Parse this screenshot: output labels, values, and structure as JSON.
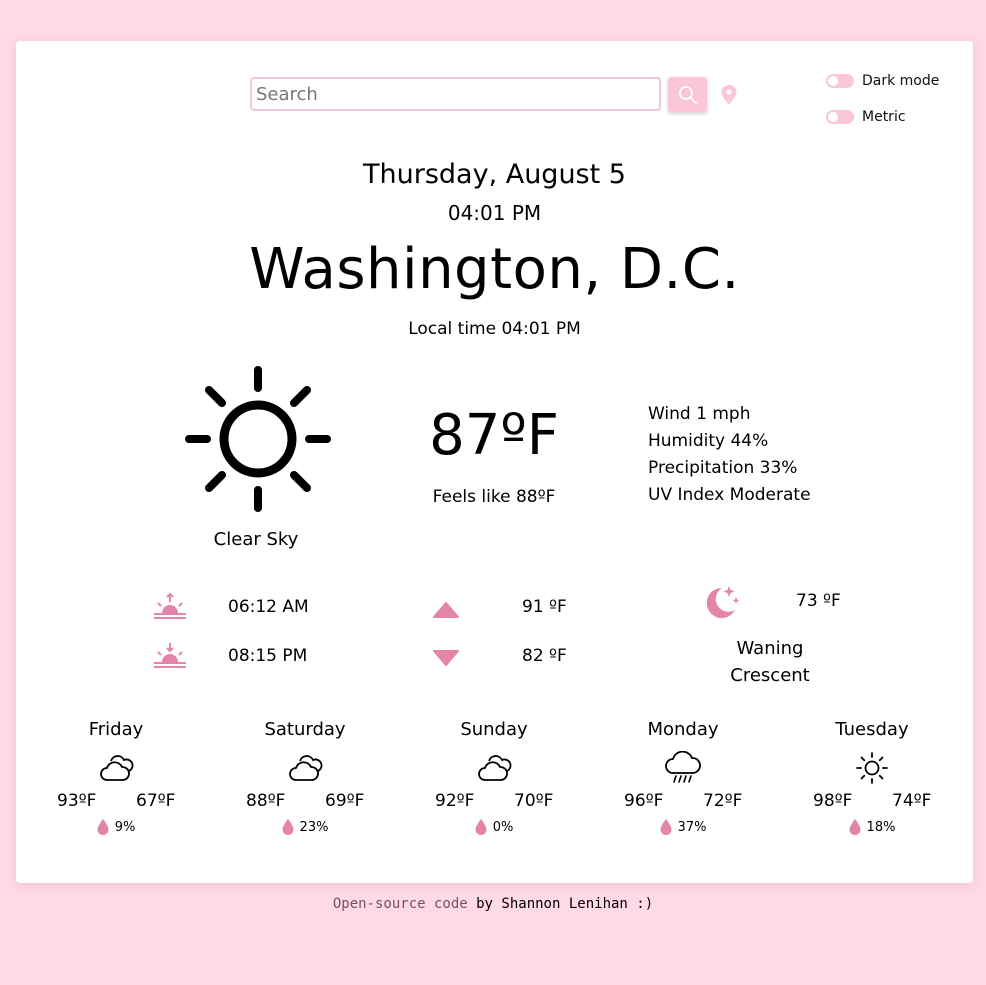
{
  "search": {
    "placeholder": "Search",
    "button_icon": "search-icon",
    "location_icon": "location-pin-icon"
  },
  "toggles": [
    {
      "label": "Dark mode"
    },
    {
      "label": "Metric"
    }
  ],
  "current": {
    "date": "Thursday, August 5",
    "time": "04:01 PM",
    "city": "Washington, D.C.",
    "local_time": "Local time 04:01 PM",
    "icon": "sun-icon",
    "condition": "Clear Sky",
    "temperature": "87ºF",
    "feels_like": "Feels like 88ºF",
    "details": [
      "Wind 1 mph",
      "Humidity 44%",
      "Precipitation 33%",
      "UV Index Moderate"
    ]
  },
  "astro": {
    "sunrise": "06:12 AM",
    "sunset": "08:15 PM",
    "high": "91 ºF",
    "low": "82 ºF",
    "moon_temp": "73 ºF",
    "moon_phase_line1": "Waning",
    "moon_phase_line2": "Crescent"
  },
  "forecast": [
    {
      "day": "Friday",
      "icon": "partly-cloudy-icon",
      "hi": "93ºF",
      "lo": "67ºF",
      "precip": "9%"
    },
    {
      "day": "Saturday",
      "icon": "partly-cloudy-icon",
      "hi": "88ºF",
      "lo": "69ºF",
      "precip": "23%"
    },
    {
      "day": "Sunday",
      "icon": "partly-cloudy-icon",
      "hi": "92ºF",
      "lo": "70ºF",
      "precip": "0%"
    },
    {
      "day": "Monday",
      "icon": "rain-cloud-icon",
      "hi": "96ºF",
      "lo": "72ºF",
      "precip": "37%"
    },
    {
      "day": "Tuesday",
      "icon": "sun-icon",
      "hi": "98ºF",
      "lo": "74ºF",
      "precip": "18%"
    }
  ],
  "footer": {
    "link": "Open-source code",
    "text": " by Shannon Lenihan :)"
  },
  "colors": {
    "accent": "#e484a8",
    "background": "#ffd9e6",
    "button": "#fbc7d7"
  }
}
